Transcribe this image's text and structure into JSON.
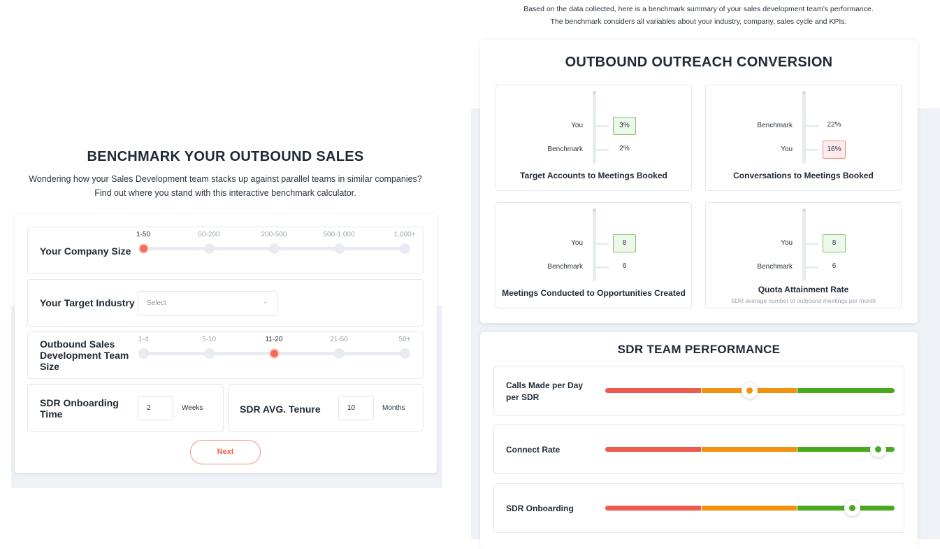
{
  "benchmark_form": {
    "title": "BENCHMARK YOUR OUTBOUND SALES",
    "subtitle_line1": "Wondering how your Sales Development team stacks up against parallel teams in similar companies?",
    "subtitle_line2": "Find out where you stand with this interactive benchmark calculator.",
    "company_size": {
      "label": "Your Company Size",
      "options": [
        "1-50",
        "50-200",
        "200-500",
        "500-1,000",
        "1,000+"
      ],
      "selected": "1-50"
    },
    "target_industry": {
      "label": "Your Target Industry",
      "placeholder": "Select"
    },
    "team_size": {
      "label": "Outbound Sales Development Team Size",
      "options": [
        "1-4",
        "5-10",
        "11-20",
        "21-50",
        "50+"
      ],
      "selected": "11-20"
    },
    "onboarding_time": {
      "label": "SDR Onboarding Time",
      "value": "2",
      "unit": "Weeks"
    },
    "tenure": {
      "label": "SDR AVG. Tenure",
      "value": "10",
      "unit": "Months"
    },
    "next_label": "Next"
  },
  "results": {
    "intro_line1": "Based on the data collected, here is a benchmark summary of your sales development team’s performance.",
    "intro_line2": "The benchmark considers all variables about your industry, company, sales cycle and KPIs.",
    "outreach": {
      "title": "OUTBOUND OUTREACH CONVERSION",
      "metrics": [
        {
          "title": "Target Accounts to Meetings Booked",
          "top_label": "You",
          "top_value": "3%",
          "bottom_label": "Benchmark",
          "bottom_value": "2%",
          "subtitle": ""
        },
        {
          "title": "Conversations to Meetings Booked",
          "top_label": "Benchmark",
          "top_value": "22%",
          "bottom_label": "You",
          "bottom_value": "16%",
          "subtitle": ""
        },
        {
          "title": "Meetings Conducted to Opportunities Created",
          "top_label": "You",
          "top_value": "8",
          "bottom_label": "Benchmark",
          "bottom_value": "6",
          "subtitle": ""
        },
        {
          "title": "Quota Attainment Rate",
          "top_label": "You",
          "top_value": "8",
          "bottom_label": "Benchmark",
          "bottom_value": "6",
          "subtitle": "SDR average number of outbound meetings per month"
        }
      ]
    },
    "performance": {
      "title": "SDR TEAM PERFORMANCE",
      "rows": [
        {
          "label": "Calls Made per Day per SDR",
          "level": 0.498,
          "knob_color": "#f4920f"
        },
        {
          "label": "Connect Rate",
          "level": 0.943,
          "knob_color": "#49aa1f"
        },
        {
          "label": "SDR Onboarding",
          "level": 0.852,
          "knob_color": "#49aa1f"
        }
      ]
    }
  },
  "colors": {
    "accent": "#f06f5b",
    "good": "#49aa1f",
    "warn": "#f4920f",
    "bad": "#ef5a4e"
  }
}
